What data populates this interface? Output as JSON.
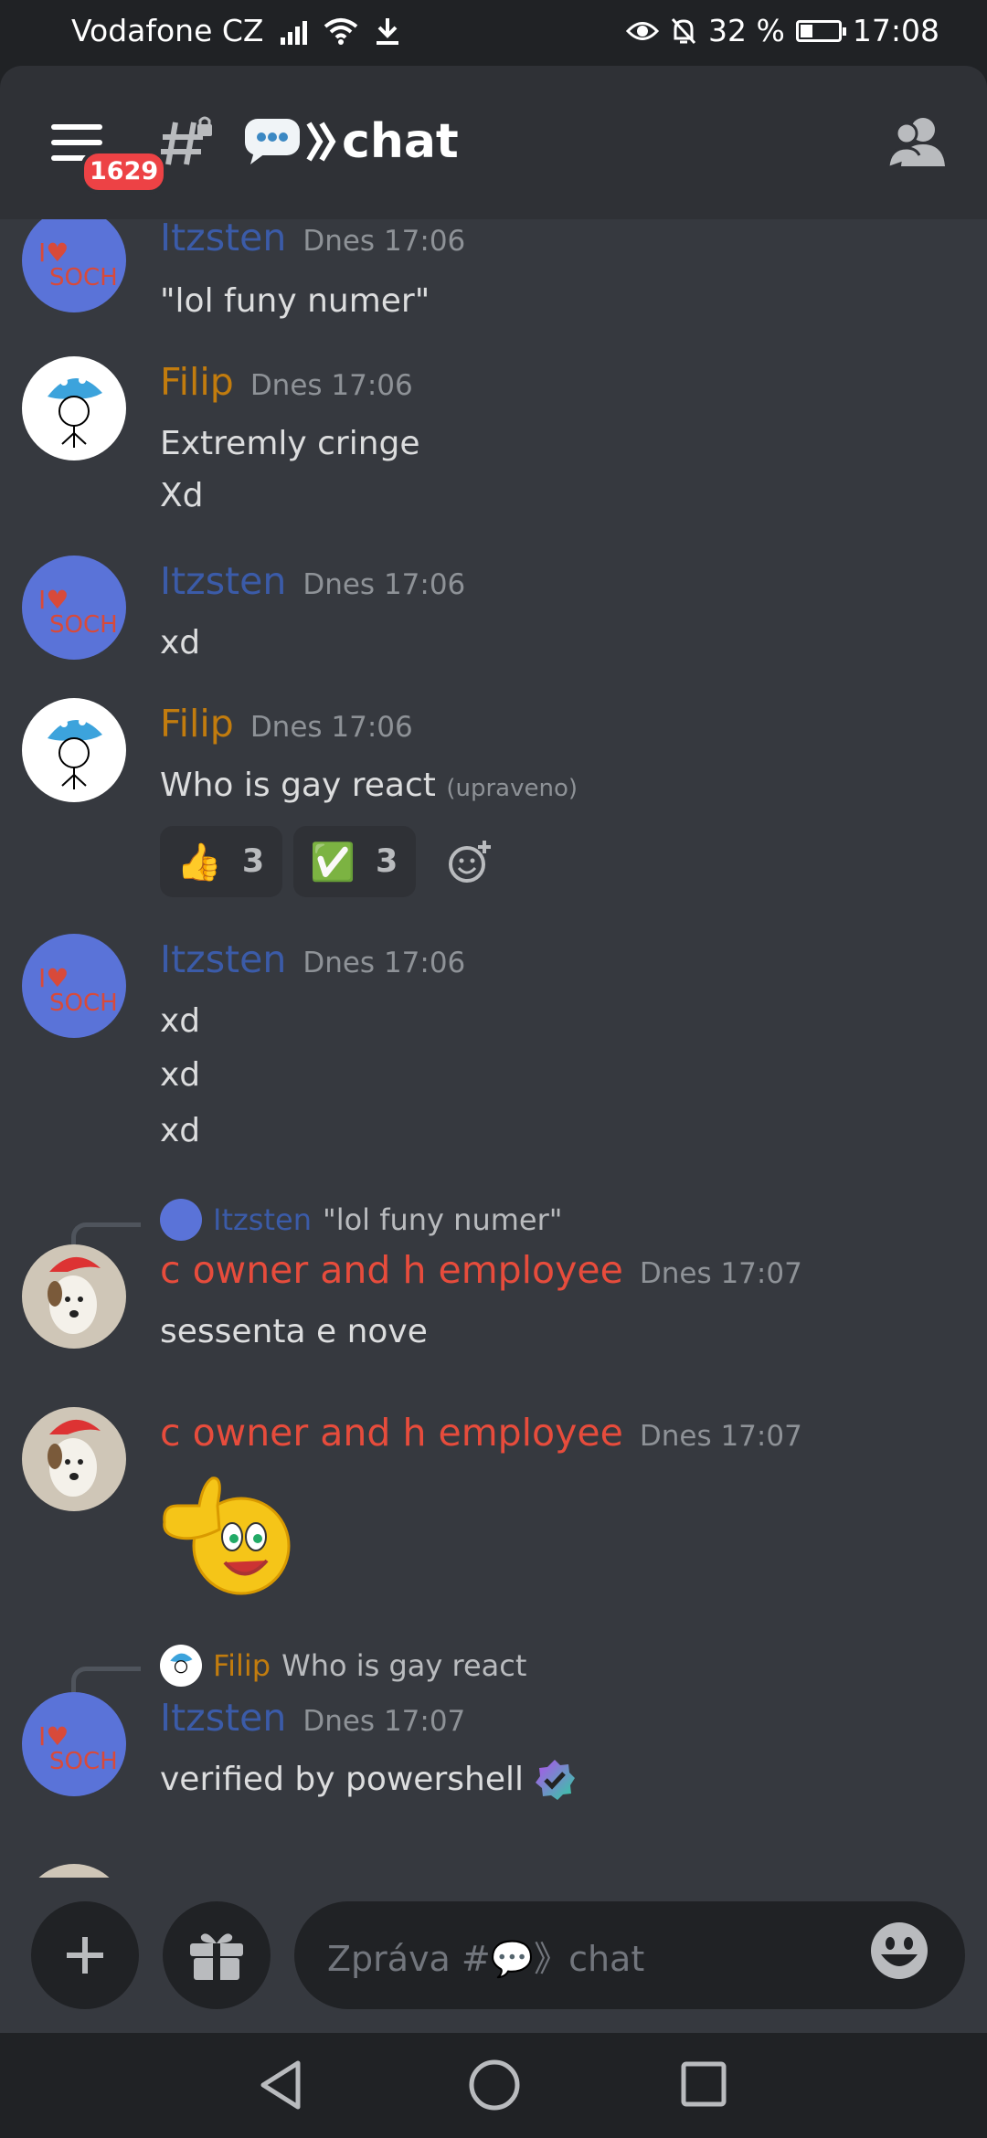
{
  "status_bar": {
    "carrier": "Vodafone CZ",
    "battery_percent": "32 %",
    "battery_level": 0.32,
    "time": "17:08"
  },
  "header": {
    "notification_badge": "1629",
    "channel_title": "chat",
    "channel_emoji": "💬"
  },
  "messages": [
    {
      "author": "Itzsten",
      "author_color": "#3b5ba8",
      "timestamp": "Dnes 17:06",
      "lines": [
        "\"lol funy numer\""
      ]
    },
    {
      "author": "Filip",
      "author_color": "#c27c0e",
      "timestamp": "Dnes 17:06",
      "lines": [
        "Extremly cringe",
        "Xd"
      ]
    },
    {
      "author": "Itzsten",
      "author_color": "#3b5ba8",
      "timestamp": "Dnes 17:06",
      "lines": [
        "xd"
      ]
    },
    {
      "author": "Filip",
      "author_color": "#c27c0e",
      "timestamp": "Dnes 17:06",
      "lines": [
        "Who is gay react"
      ],
      "edited": "(upraveno)",
      "reactions": [
        {
          "emoji": "👍",
          "count": "3"
        },
        {
          "emoji": "✅",
          "count": "3"
        }
      ]
    },
    {
      "author": "Itzsten",
      "author_color": "#3b5ba8",
      "timestamp": "Dnes 17:06",
      "lines": [
        "xd",
        "xd",
        "xd"
      ]
    },
    {
      "author": "c owner and h employee",
      "author_color": "#e74c3c",
      "timestamp": "Dnes 17:07",
      "lines": [
        "sessenta e nove"
      ],
      "reply_to": {
        "author": "Itzsten",
        "text": "\"lol funy numer\""
      }
    },
    {
      "author": "c owner and h employee",
      "author_color": "#e74c3c",
      "timestamp": "Dnes 17:07",
      "lines": [],
      "emoji_image": "thumbs-up-smiley"
    },
    {
      "author": "Itzsten",
      "author_color": "#3b5ba8",
      "timestamp": "Dnes 17:07",
      "lines": [
        "verified by powershell"
      ],
      "reply_to": {
        "author": "Filip",
        "text": "Who is gay react"
      }
    }
  ],
  "input": {
    "placeholder": "Zpráva #💬》chat"
  },
  "icons": {
    "menu": "hamburger-icon",
    "channel": "locked-hash-icon",
    "members": "members-icon",
    "add": "plus-icon",
    "gift": "gift-icon",
    "emoji": "emoji-icon",
    "add_reaction": "add-reaction-icon",
    "verified": "verified-badge-icon",
    "nav_back": "back-triangle-icon",
    "nav_home": "home-circle-icon",
    "nav_recents": "recents-square-icon"
  }
}
